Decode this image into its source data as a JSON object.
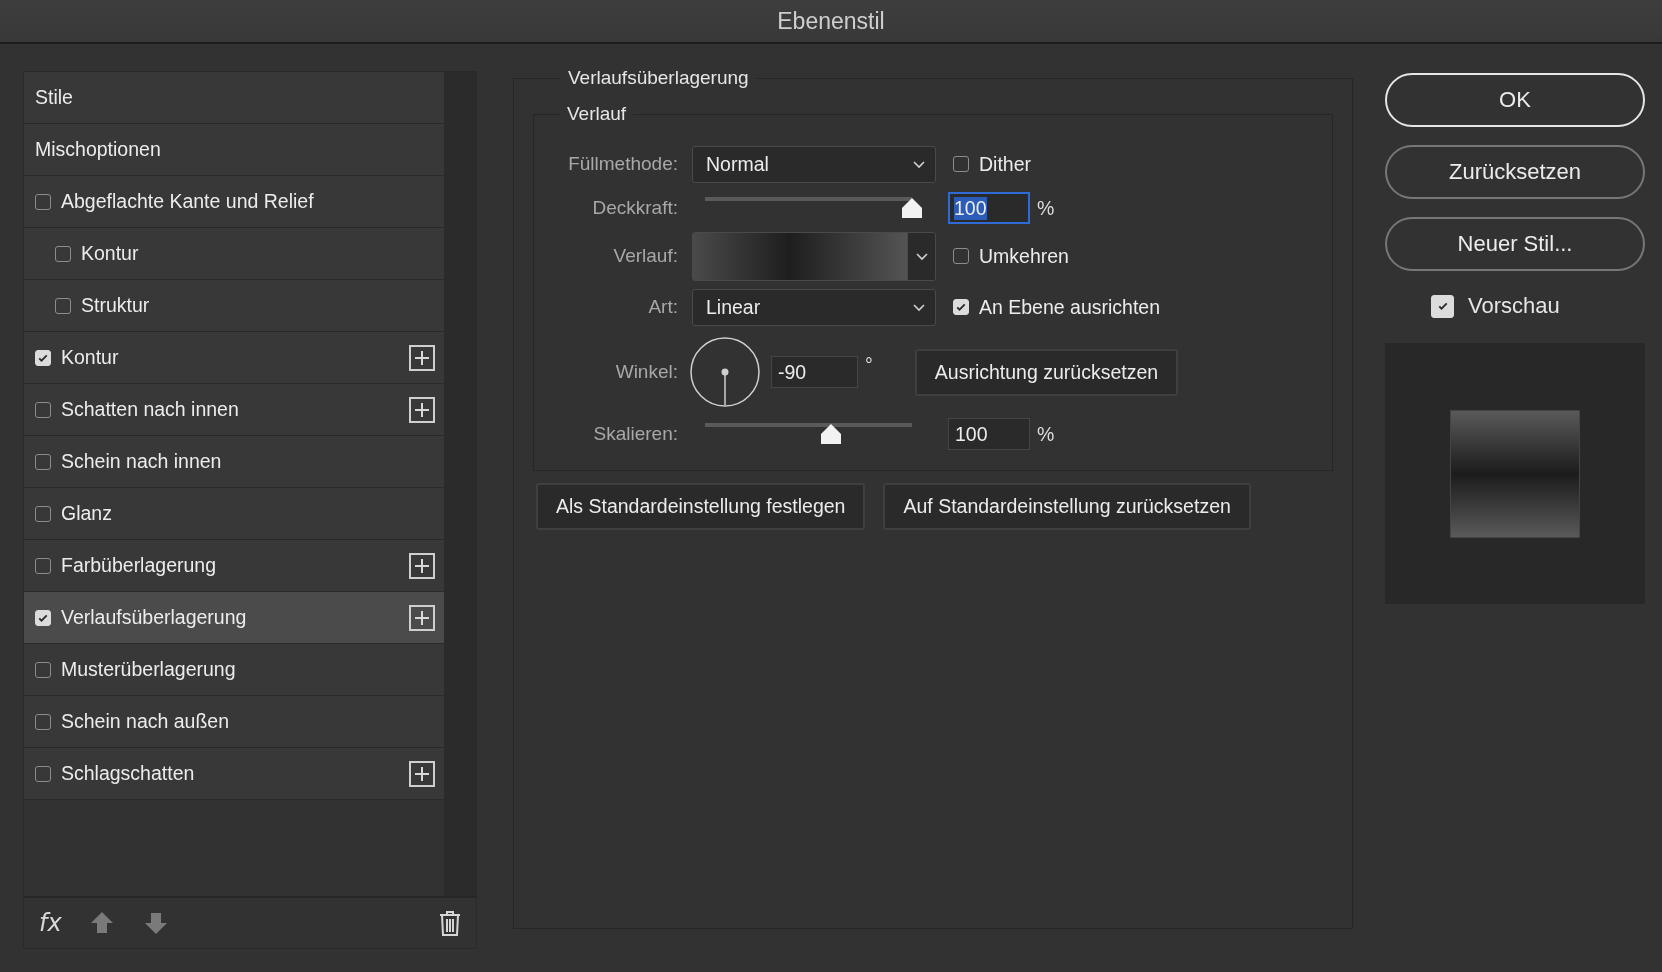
{
  "window": {
    "title": "Ebenenstil"
  },
  "styles_list": {
    "items": [
      {
        "label": "Stile",
        "kind": "header",
        "selected": false
      },
      {
        "label": "Mischoptionen",
        "kind": "header",
        "selected": false
      },
      {
        "label": "Abgeflachte Kante und Relief",
        "kind": "checkbox",
        "checked": false,
        "addable": false,
        "selected": false,
        "children": [
          {
            "label": "Kontur",
            "kind": "checkbox",
            "checked": false,
            "addable": false,
            "selected": false
          },
          {
            "label": "Struktur",
            "kind": "checkbox",
            "checked": false,
            "addable": false,
            "selected": false
          }
        ]
      },
      {
        "label": "Kontur",
        "kind": "checkbox",
        "checked": true,
        "addable": true,
        "selected": false
      },
      {
        "label": "Schatten nach innen",
        "kind": "checkbox",
        "checked": false,
        "addable": true,
        "selected": false
      },
      {
        "label": "Schein nach innen",
        "kind": "checkbox",
        "checked": false,
        "addable": false,
        "selected": false
      },
      {
        "label": "Glanz",
        "kind": "checkbox",
        "checked": false,
        "addable": false,
        "selected": false
      },
      {
        "label": "Farbüberlagerung",
        "kind": "checkbox",
        "checked": false,
        "addable": true,
        "selected": false
      },
      {
        "label": "Verlaufsüberlagerung",
        "kind": "checkbox",
        "checked": true,
        "addable": true,
        "selected": true
      },
      {
        "label": "Musterüberlagerung",
        "kind": "checkbox",
        "checked": false,
        "addable": false,
        "selected": false
      },
      {
        "label": "Schein nach außen",
        "kind": "checkbox",
        "checked": false,
        "addable": false,
        "selected": false
      },
      {
        "label": "Schlagschatten",
        "kind": "checkbox",
        "checked": false,
        "addable": true,
        "selected": false
      }
    ],
    "footer_fx": "fx"
  },
  "gradient_overlay": {
    "title": "Verlaufsüberlagerung",
    "group_title": "Verlauf",
    "blend_mode": {
      "label": "Füllmethode:",
      "value": "Normal",
      "option": {
        "label": "Dither",
        "checked": false
      }
    },
    "opacity": {
      "label": "Deckkraft:",
      "level": 1.0,
      "value": "100",
      "unit": "%",
      "focused": true
    },
    "gradient": {
      "label": "Verlauf:",
      "option": {
        "label": "Umkehren",
        "checked": false
      }
    },
    "style": {
      "label": "Art:",
      "value": "Linear",
      "option": {
        "label": "An Ebene ausrichten",
        "checked": true
      }
    },
    "angle": {
      "label": "Winkel:",
      "value": "-90",
      "unit": "°",
      "button": "Ausrichtung zurücksetzen"
    },
    "scale": {
      "label": "Skalieren:",
      "level": 0.61,
      "value": "100",
      "unit": "%"
    },
    "buttons": [
      "Als Standardeinstellung festlegen",
      "Auf Standardeinstellung zurücksetzen"
    ]
  },
  "actions": {
    "buttons": [
      {
        "label": "OK",
        "default": true
      },
      {
        "label": "Zurücksetzen",
        "default": false
      },
      {
        "label": "Neuer Stil...",
        "default": false
      }
    ],
    "preview": {
      "label": "Vorschau",
      "checked": true
    }
  }
}
